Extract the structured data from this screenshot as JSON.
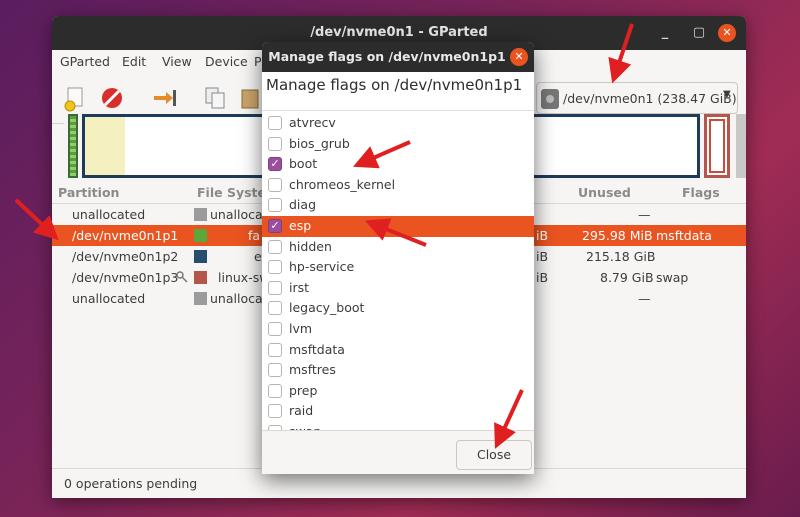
{
  "window": {
    "title": "/dev/nvme0n1 - GParted",
    "controls": [
      "_",
      "▢",
      "✕"
    ]
  },
  "menu": [
    "GParted",
    "Edit",
    "View",
    "Device",
    "P"
  ],
  "device": {
    "label": "/dev/nvme0n1 (238.47 GiB)",
    "arrow": "▼"
  },
  "table": {
    "headers": {
      "partition": "Partition",
      "filesystem": "File System",
      "unused": "Unused",
      "flags": "Flags"
    },
    "rows": [
      {
        "partition": "unallocated",
        "fs": "unallocated",
        "fs_color": "#9b9b9b",
        "size_tail": "",
        "unused": "—",
        "flags": ""
      },
      {
        "partition": "/dev/nvme0n1p1",
        "fs": "fa",
        "fs_color": "#5aa83a",
        "size_tail": "iB",
        "unused": "295.98 MiB",
        "flags": "msftdata"
      },
      {
        "partition": "/dev/nvme0n1p2",
        "fs": "e",
        "fs_color": "#2a4d6e",
        "size_tail": "iB",
        "unused": "215.18 GiB",
        "flags": ""
      },
      {
        "partition": "/dev/nvme0n1p3",
        "fs": "linux-sw",
        "fs_color": "#b5564c",
        "size_tail": "iB",
        "unused": "8.79 GiB",
        "flags": "swap"
      },
      {
        "partition": "unallocated",
        "fs": "unallocated",
        "fs_color": "#9b9b9b",
        "size_tail": "",
        "unused": "—",
        "flags": ""
      }
    ]
  },
  "status": "0 operations pending",
  "dialog": {
    "title": "Manage flags on /dev/nvme0n1p1",
    "heading": "Manage flags on /dev/nvme0n1p1",
    "close_label": "Close",
    "flags": [
      {
        "name": "atvrecv",
        "checked": false
      },
      {
        "name": "bios_grub",
        "checked": false
      },
      {
        "name": "boot",
        "checked": true
      },
      {
        "name": "chromeos_kernel",
        "checked": false
      },
      {
        "name": "diag",
        "checked": false
      },
      {
        "name": "esp",
        "checked": true
      },
      {
        "name": "hidden",
        "checked": false
      },
      {
        "name": "hp-service",
        "checked": false
      },
      {
        "name": "irst",
        "checked": false
      },
      {
        "name": "legacy_boot",
        "checked": false
      },
      {
        "name": "lvm",
        "checked": false
      },
      {
        "name": "msftdata",
        "checked": false
      },
      {
        "name": "msftres",
        "checked": false
      },
      {
        "name": "prep",
        "checked": false
      },
      {
        "name": "raid",
        "checked": false
      },
      {
        "name": "swap",
        "checked": false
      }
    ],
    "selected_flag": "esp"
  },
  "colors": {
    "accent": "#e95420",
    "check": "#9c4f9c",
    "titlebar": "#2c2c2c",
    "annotation": "#e02020"
  }
}
